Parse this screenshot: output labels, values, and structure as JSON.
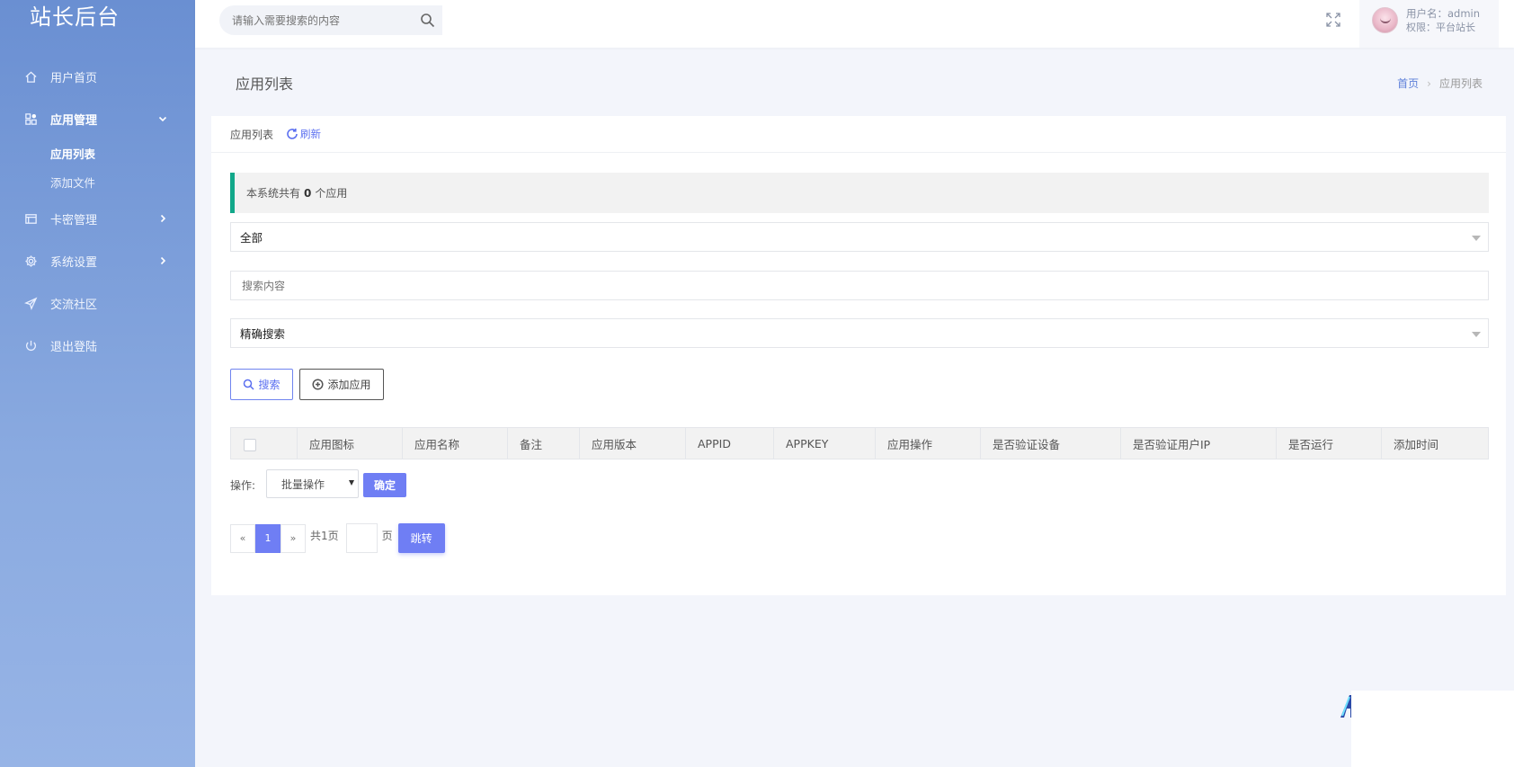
{
  "sidebar": {
    "brand": "站长后台",
    "items": [
      {
        "label": "用户首页",
        "icon": "home-icon"
      },
      {
        "label": "应用管理",
        "icon": "apps-icon"
      },
      {
        "label": "卡密管理",
        "icon": "card-icon"
      },
      {
        "label": "系统设置",
        "icon": "gear-icon"
      },
      {
        "label": "交流社区",
        "icon": "send-icon"
      },
      {
        "label": "退出登陆",
        "icon": "power-icon"
      }
    ],
    "subitems": [
      {
        "label": "应用列表"
      },
      {
        "label": "添加文件"
      }
    ]
  },
  "header": {
    "search_placeholder": "请输入需要搜索的内容",
    "user_name": "用户名：admin",
    "user_role": "权限：平台站长"
  },
  "page": {
    "title": "应用列表",
    "breadcrumb": [
      "首页",
      "应用列表"
    ]
  },
  "card": {
    "title": "应用列表",
    "refresh_label": "刷新",
    "notice_prefix": "本系统共有",
    "notice_count": "0",
    "notice_suffix": "个应用",
    "filter_select": "全部",
    "search_placeholder": "搜索内容",
    "mode_select": "精确搜索",
    "search_button": "搜索",
    "add_button": "添加应用",
    "table_headers": [
      "应用图标",
      "应用名称",
      "备注",
      "应用版本",
      "APPID",
      "APPKEY",
      "应用操作",
      "是否验证设备",
      "是否验证用户IP",
      "是否运行",
      "添加时间"
    ],
    "op_label": "操作:",
    "batch_select": "批量操作",
    "confirm_button": "确定",
    "pager": {
      "prev": "«",
      "current": "1",
      "next": "»",
      "total": "共1页",
      "unit": "页",
      "jump": "跳转"
    }
  },
  "colors": {
    "sidebar_top": "#6a8fd2",
    "sidebar_bottom": "#97b4e6",
    "accent": "#6f7ef4",
    "notice_border": "#12a88a"
  }
}
